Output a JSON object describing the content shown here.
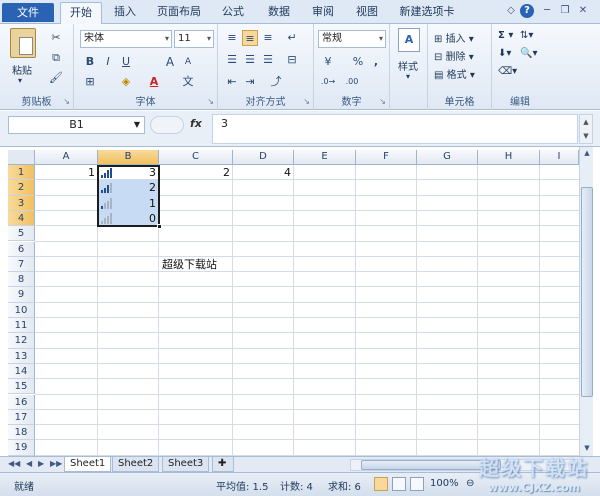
{
  "tabs": {
    "file": "文件",
    "items": [
      "开始",
      "插入",
      "页面布局",
      "公式",
      "数据",
      "审阅",
      "视图",
      "新建选项卡"
    ]
  },
  "ribbon": {
    "clipboard": {
      "paste": "粘贴",
      "label": "剪贴板"
    },
    "font": {
      "name": "宋体",
      "size": "11",
      "label": "字体",
      "bold": "B",
      "italic": "I",
      "underline": "U",
      "grow": "A",
      "shrink": "A"
    },
    "alignment": {
      "label": "对齐方式"
    },
    "number": {
      "format": "常规",
      "percent": "%",
      "comma": ",",
      "label": "数字"
    },
    "styles": {
      "label": "样式"
    },
    "cells": {
      "insert": "插入",
      "delete": "删除",
      "format": "格式",
      "label": "单元格"
    },
    "editing": {
      "sigma": "Σ",
      "label": "编辑"
    }
  },
  "formula_bar": {
    "name_box": "B1",
    "fx": "fx",
    "value": "3"
  },
  "columns": [
    "A",
    "B",
    "C",
    "D",
    "E",
    "F",
    "G",
    "H",
    "I"
  ],
  "rows": [
    "1",
    "2",
    "3",
    "4",
    "5",
    "6",
    "7",
    "8",
    "9",
    "10",
    "11",
    "12",
    "13",
    "14",
    "15",
    "16",
    "17",
    "18",
    "19"
  ],
  "cells": {
    "A1": "1",
    "B1": "3",
    "C1": "2",
    "D1": "4",
    "B2": "2",
    "B3": "1",
    "B4": "0",
    "C7": "超级下载站"
  },
  "sheets": [
    "Sheet1",
    "Sheet2",
    "Sheet3"
  ],
  "status": {
    "ready": "就绪",
    "average": "平均值: 1.5",
    "count": "计数: 4",
    "sum": "求和: 6",
    "zoom": "100%"
  },
  "watermark": {
    "line1": "超级下载站",
    "line2": "www.CJXZ.com"
  }
}
